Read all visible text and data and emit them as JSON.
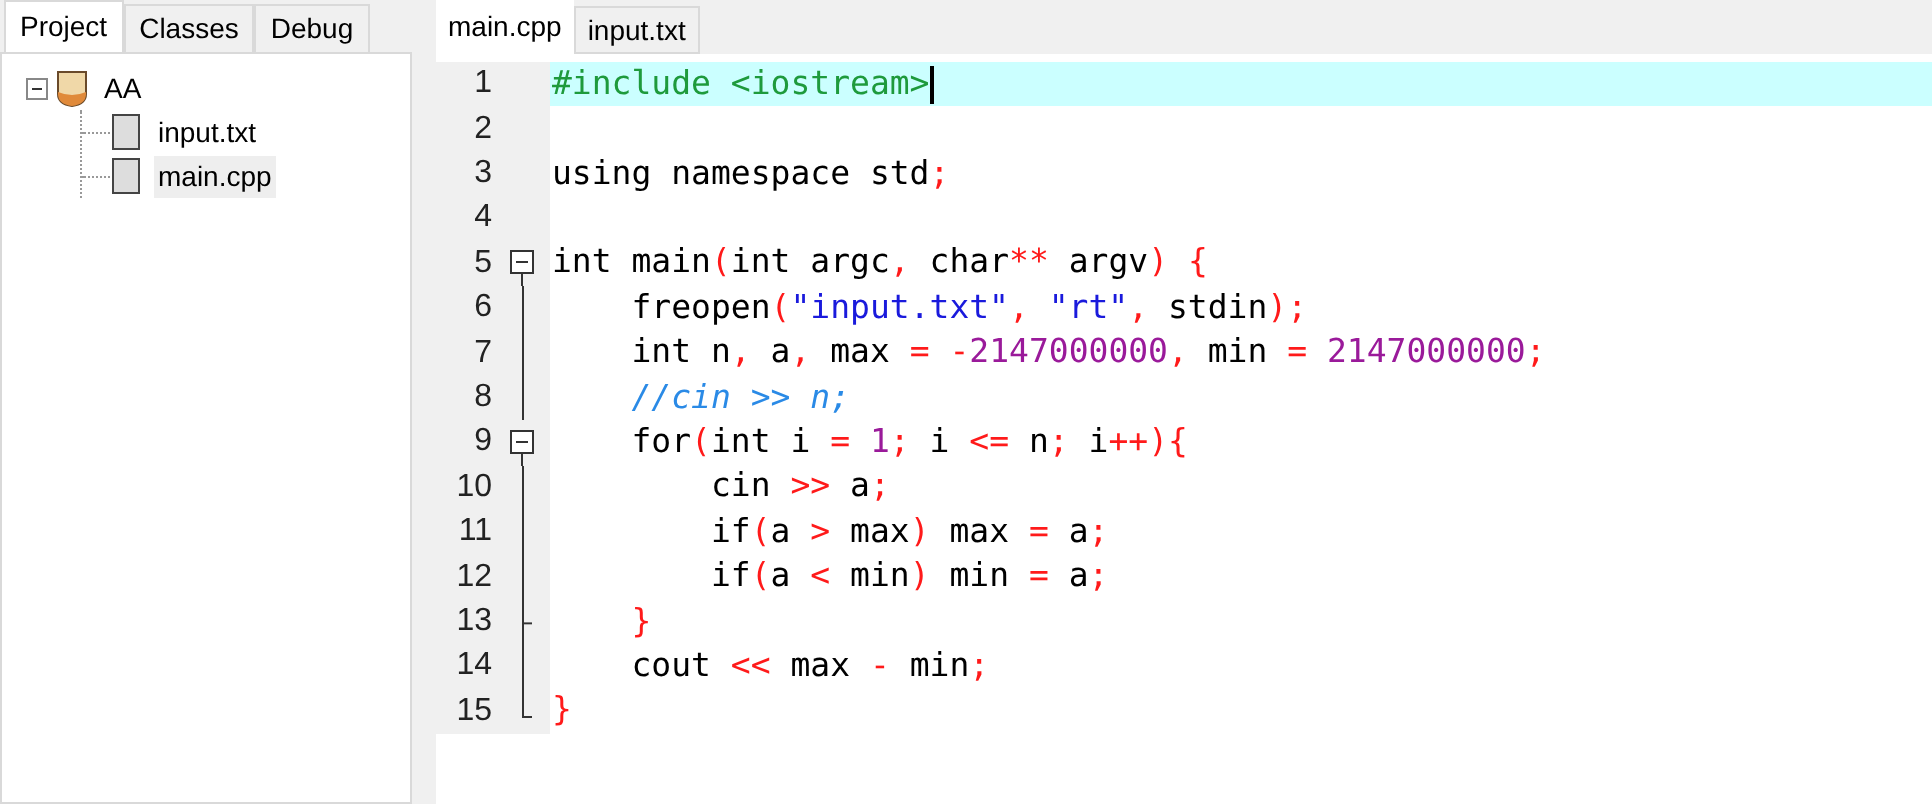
{
  "sidebar": {
    "tabs": [
      {
        "label": "Project",
        "selected": true
      },
      {
        "label": "Classes",
        "selected": false
      },
      {
        "label": "Debug",
        "selected": false
      }
    ],
    "tree": [
      {
        "label": "AA",
        "expanded": true,
        "kind": "project",
        "selected": false,
        "children": [
          {
            "label": "input.txt",
            "kind": "file",
            "selected": false
          },
          {
            "label": "main.cpp",
            "kind": "file",
            "selected": true
          }
        ]
      }
    ]
  },
  "editor": {
    "tabs": [
      {
        "label": "main.cpp",
        "selected": true
      },
      {
        "label": "input.txt",
        "selected": false
      }
    ],
    "lines": [
      {
        "number": "1",
        "kind": "plain",
        "current": true,
        "tokens": [
          {
            "kind": "pre",
            "text": "#include <iostream>"
          }
        ]
      },
      {
        "number": "2",
        "kind": "plain",
        "current": false
      },
      {
        "number": "3",
        "kind": "plain",
        "current": false,
        "tokens": [
          {
            "kind": "id",
            "text": "using namespace std"
          },
          {
            "kind": "sym",
            "text": ";"
          }
        ]
      },
      {
        "number": "4",
        "kind": "plain",
        "current": false
      },
      {
        "number": "5",
        "kind": "fold_start",
        "current": false,
        "tokens": [
          {
            "kind": "id",
            "text": "int main"
          },
          {
            "kind": "sym",
            "text": "("
          },
          {
            "kind": "id",
            "text": "int argc"
          },
          {
            "kind": "sym",
            "text": ", "
          },
          {
            "kind": "id",
            "text": "char"
          },
          {
            "kind": "sym",
            "text": "** "
          },
          {
            "kind": "id",
            "text": "argv"
          },
          {
            "kind": "sym",
            "text": ") {"
          }
        ]
      },
      {
        "number": "6",
        "kind": "fold_body",
        "current": false,
        "tokens": [
          {
            "kind": "id",
            "text": "    freopen"
          },
          {
            "kind": "sym",
            "text": "("
          },
          {
            "kind": "str",
            "text": "\"input.txt\""
          },
          {
            "kind": "sym",
            "text": ", "
          },
          {
            "kind": "str",
            "text": "\"rt\""
          },
          {
            "kind": "sym",
            "text": ", "
          },
          {
            "kind": "id",
            "text": "stdin"
          },
          {
            "kind": "sym",
            "text": ");"
          }
        ]
      },
      {
        "number": "7",
        "kind": "fold_body",
        "current": false,
        "tokens": [
          {
            "kind": "id",
            "text": "    int n"
          },
          {
            "kind": "sym",
            "text": ", "
          },
          {
            "kind": "id",
            "text": "a"
          },
          {
            "kind": "sym",
            "text": ", "
          },
          {
            "kind": "id",
            "text": "max "
          },
          {
            "kind": "sym",
            "text": "= -"
          },
          {
            "kind": "num",
            "text": "2147000000"
          },
          {
            "kind": "sym",
            "text": ", "
          },
          {
            "kind": "id",
            "text": "min "
          },
          {
            "kind": "sym",
            "text": "= "
          },
          {
            "kind": "num",
            "text": "2147000000"
          },
          {
            "kind": "sym",
            "text": ";"
          }
        ]
      },
      {
        "number": "8",
        "kind": "fold_body",
        "current": false,
        "tokens": [
          {
            "kind": "com",
            "text": "    //cin >> n;"
          }
        ]
      },
      {
        "number": "9",
        "kind": "fold_start",
        "current": false,
        "tokens": [
          {
            "kind": "id",
            "text": "    for"
          },
          {
            "kind": "sym",
            "text": "("
          },
          {
            "kind": "id",
            "text": "int i "
          },
          {
            "kind": "sym",
            "text": "= "
          },
          {
            "kind": "num",
            "text": "1"
          },
          {
            "kind": "sym",
            "text": "; "
          },
          {
            "kind": "id",
            "text": "i "
          },
          {
            "kind": "sym",
            "text": "<= "
          },
          {
            "kind": "id",
            "text": "n"
          },
          {
            "kind": "sym",
            "text": "; "
          },
          {
            "kind": "id",
            "text": "i"
          },
          {
            "kind": "sym",
            "text": "++){"
          }
        ]
      },
      {
        "number": "10",
        "kind": "fold_body",
        "current": false,
        "tokens": [
          {
            "kind": "id",
            "text": "        cin "
          },
          {
            "kind": "sym",
            "text": ">> "
          },
          {
            "kind": "id",
            "text": "a"
          },
          {
            "kind": "sym",
            "text": ";"
          }
        ]
      },
      {
        "number": "11",
        "kind": "fold_body",
        "current": false,
        "tokens": [
          {
            "kind": "id",
            "text": "        if"
          },
          {
            "kind": "sym",
            "text": "("
          },
          {
            "kind": "id",
            "text": "a "
          },
          {
            "kind": "sym",
            "text": "> "
          },
          {
            "kind": "id",
            "text": "max"
          },
          {
            "kind": "sym",
            "text": ") "
          },
          {
            "kind": "id",
            "text": "max "
          },
          {
            "kind": "sym",
            "text": "= "
          },
          {
            "kind": "id",
            "text": "a"
          },
          {
            "kind": "sym",
            "text": ";"
          }
        ]
      },
      {
        "number": "12",
        "kind": "fold_body",
        "current": false,
        "tokens": [
          {
            "kind": "id",
            "text": "        if"
          },
          {
            "kind": "sym",
            "text": "("
          },
          {
            "kind": "id",
            "text": "a "
          },
          {
            "kind": "sym",
            "text": "< "
          },
          {
            "kind": "id",
            "text": "min"
          },
          {
            "kind": "sym",
            "text": ") "
          },
          {
            "kind": "id",
            "text": "min "
          },
          {
            "kind": "sym",
            "text": "= "
          },
          {
            "kind": "id",
            "text": "a"
          },
          {
            "kind": "sym",
            "text": ";"
          }
        ]
      },
      {
        "number": "13",
        "kind": "fold_inner_end",
        "current": false,
        "tokens": [
          {
            "kind": "sym",
            "text": "    }"
          }
        ]
      },
      {
        "number": "14",
        "kind": "fold_body",
        "current": false,
        "tokens": [
          {
            "kind": "id",
            "text": "    cout "
          },
          {
            "kind": "sym",
            "text": "<< "
          },
          {
            "kind": "id",
            "text": "max "
          },
          {
            "kind": "sym",
            "text": "- "
          },
          {
            "kind": "id",
            "text": "min"
          },
          {
            "kind": "sym",
            "text": ";"
          }
        ]
      },
      {
        "number": "15",
        "kind": "fold_end",
        "current": false,
        "tokens": [
          {
            "kind": "sym",
            "text": "}"
          }
        ]
      }
    ]
  }
}
